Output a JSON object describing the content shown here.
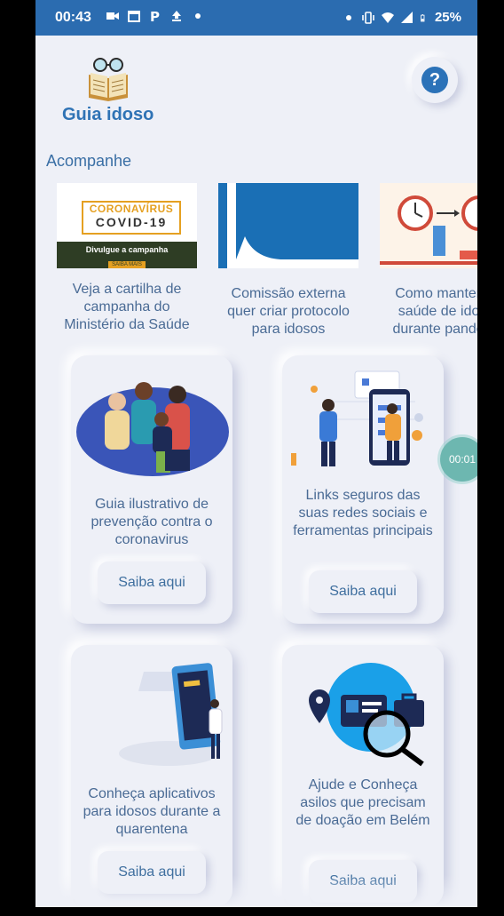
{
  "status_bar": {
    "time": "00:43",
    "battery_percent": "25%",
    "left_icons": [
      "video-icon",
      "calendar-icon",
      "parking-icon",
      "upload-icon",
      "dot-icon"
    ],
    "right_icons": [
      "dot-icon",
      "vibrate-icon",
      "wifi-icon",
      "signal-icon",
      "battery-icon"
    ]
  },
  "header": {
    "app_title": "Guia idoso",
    "logo_icon": "book-glasses-icon",
    "help_label": "?"
  },
  "section": {
    "title": "Acompanhe"
  },
  "carousel": [
    {
      "caption": "Veja a cartilha de campanha do Ministério da Saúde",
      "thumb": {
        "line1": "CORONAVÍRUS",
        "line2": "COVID-19",
        "line3": "Divulgue a campanha",
        "button": "SAIBA MAIS"
      }
    },
    {
      "caption": "Comissão externa quer criar protocolo para idosos"
    },
    {
      "caption": "Como manter a a saúde de idosos durante pandemia"
    }
  ],
  "cards": [
    {
      "text": "Guia ilustrativo de prevenção contra o coronavirus",
      "button": "Saiba aqui"
    },
    {
      "text": "Links seguros das suas redes sociais e ferramentas principais",
      "button": "Saiba aqui"
    },
    {
      "text": "Conheça aplicativos para idosos durante a quarentena",
      "button": "Saiba aqui"
    },
    {
      "text": "Ajude e Conheça asilos que precisam de doação em Belém",
      "button": "Saiba aqui"
    }
  ],
  "timer": {
    "label": "00:01"
  },
  "colors": {
    "status_bar": "#2b6cb0",
    "accent": "#2f73b5",
    "background": "#eef0f7",
    "text": "#4a6b95"
  }
}
